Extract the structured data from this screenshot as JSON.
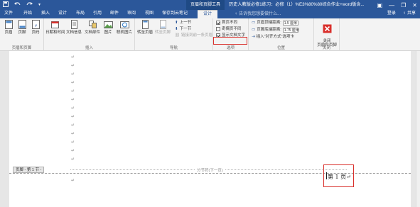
{
  "titlebar": {
    "save_icon": "save-icon",
    "undo_icon": "undo-icon",
    "redo_icon": "redo-icon",
    "customize_icon": "customize-qat-icon",
    "context_tool": "页眉和页脚工具",
    "doc_title": "历史人教版必修1练习：必修（1）%E3%80%80综合作业+word版含...",
    "buttons": {
      "ribbon_display": "▣",
      "minimize": "—",
      "restore": "❐",
      "close": "✕"
    }
  },
  "tabs": {
    "file": "文件",
    "home": "开始",
    "insert": "插入",
    "design_doc": "设计",
    "layout": "布局",
    "references": "引用",
    "mailings": "邮件",
    "review": "审阅",
    "view": "视图",
    "save_note": "保存到云笔记",
    "design_active": "设计",
    "tell_me": "♀ 告诉我您想要做什么...",
    "login": "登录",
    "share": "♀ 共享"
  },
  "ribbon": {
    "header_footer_group": {
      "label": "页眉和页脚",
      "header": "页眉",
      "footer": "页脚",
      "page_number": "页码"
    },
    "insert_group": {
      "label": "插入",
      "date_time": "日期和时间",
      "doc_info": "文档信息",
      "doc_parts": "文档部件",
      "picture": "图片",
      "online_picture": "联机图片"
    },
    "nav_group": {
      "label": "导航",
      "goto_header": "转至页眉",
      "goto_footer": "转至页脚",
      "prev": "上一节",
      "next": "下一节",
      "link_prev": "链接到前一条页眉"
    },
    "options_group": {
      "label": "选项",
      "first_page_diff": "首页不同",
      "odd_even_diff": "奇偶页不同",
      "show_doc_text": "显示文档文字",
      "first_page_checked": true,
      "odd_even_checked": false,
      "show_text_checked": true
    },
    "position_group": {
      "label": "位置",
      "header_top": "页眉顶端距离:",
      "header_top_value": "1.5 厘米",
      "footer_bottom": "页脚底端距离:",
      "footer_bottom_value": "1.75 厘米",
      "insert_align_tab": "插入\"对齐方式\"选项卡"
    },
    "close_group": {
      "label": "关闭",
      "close_btn": "关闭\n页眉和页脚"
    }
  },
  "document": {
    "paragraph_mark": "↵",
    "section_break": "分节符(下一页)",
    "footer_tag": "页脚 - 第 1 节 -",
    "page_number_text": "第 1 页↵"
  },
  "colors": {
    "accent": "#2b579a",
    "highlight_box": "#d9302c",
    "close_red": "#d9302c"
  }
}
